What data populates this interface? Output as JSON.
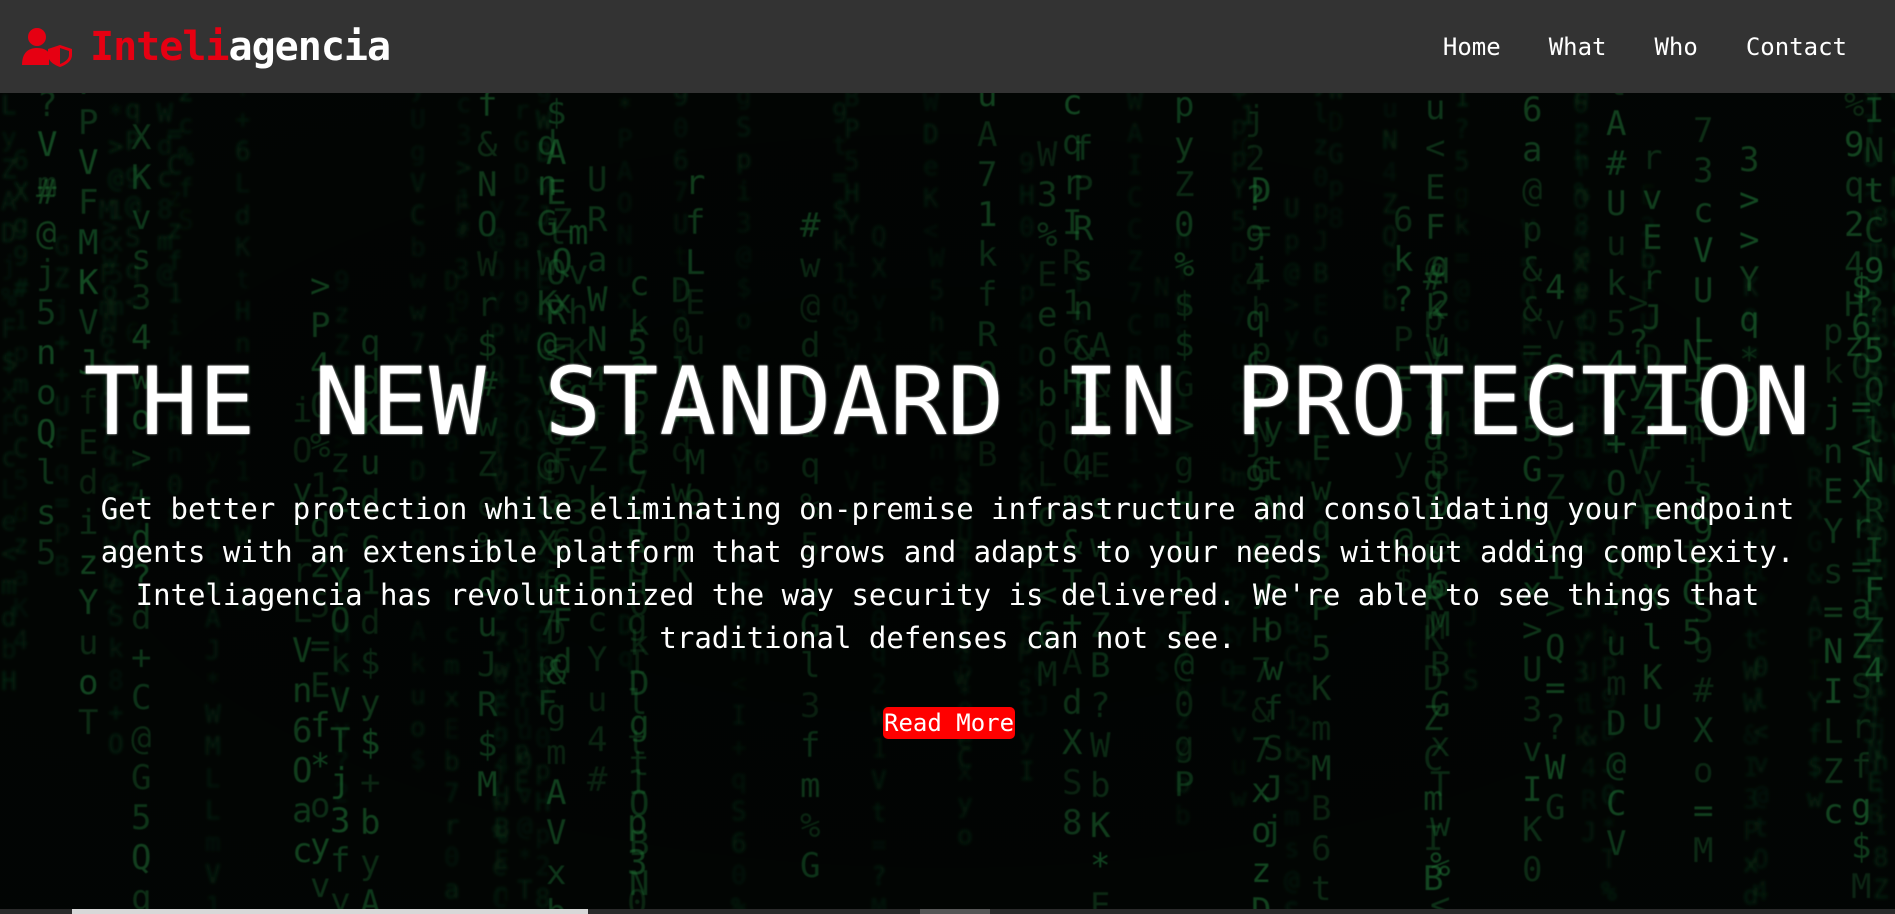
{
  "brand": {
    "name_red": "Inteli",
    "name_white": "agencia",
    "icon": "user-shield-icon",
    "red_color": "#e60012"
  },
  "nav": {
    "items": [
      {
        "label": "Home"
      },
      {
        "label": "What"
      },
      {
        "label": "Who"
      },
      {
        "label": "Contact"
      }
    ]
  },
  "hero": {
    "title": "THE NEW STANDARD IN PROTECTION",
    "description": "Get better protection while eliminating on-premise infrastructure and consolidating your endpoint agents with an extensible platform that grows and adapts to your needs without adding complexity. Inteliagencia has revolutionized the way security is delivered. We're able to see things that traditional defenses can not see.",
    "button_label": "Read More",
    "button_color": "#ff0000",
    "background": "green matrix code rain"
  },
  "colors": {
    "navbar": "#333333",
    "matrix_green": "#1f8a3a"
  }
}
